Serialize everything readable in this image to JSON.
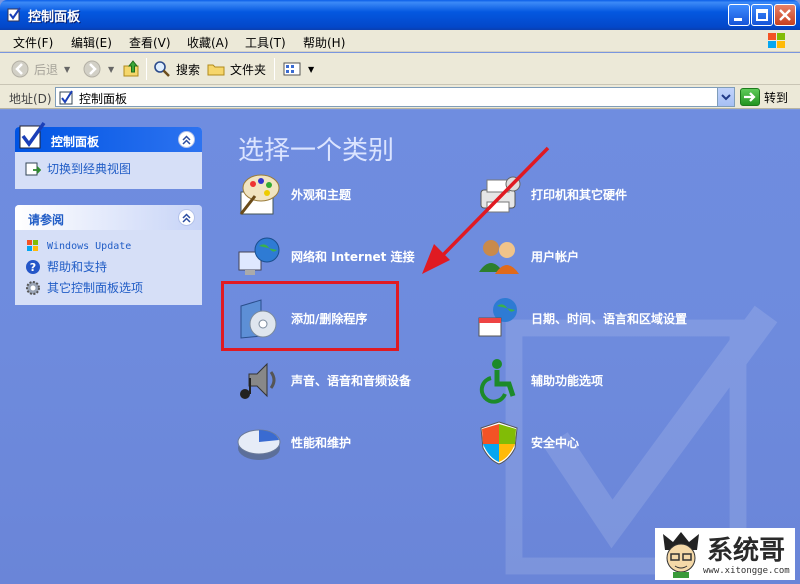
{
  "window": {
    "title": "控制面板"
  },
  "menu": [
    "文件(F)",
    "编辑(E)",
    "查看(V)",
    "收藏(A)",
    "工具(T)",
    "帮助(H)"
  ],
  "toolbar": {
    "back": "后退",
    "search": "搜索",
    "folders": "文件夹"
  },
  "address": {
    "label": "地址(D)",
    "value": "控制面板",
    "go": "转到"
  },
  "sidebar": {
    "panel_title": "控制面板",
    "switch_view": "切换到经典视图",
    "see_also_title": "请参阅",
    "see_also": [
      "Windows Update",
      "帮助和支持",
      "其它控制面板选项"
    ]
  },
  "main": {
    "heading": "选择一个类别",
    "categories": [
      "外观和主题",
      "打印机和其它硬件",
      "网络和 Internet 连接",
      "用户帐户",
      "添加/删除程序",
      "日期、时间、语言和区域设置",
      "声音、语音和音频设备",
      "辅助功能选项",
      "性能和维护",
      "安全中心"
    ]
  },
  "watermark": {
    "brand": "系统哥",
    "url": "www.xitongge.com"
  }
}
